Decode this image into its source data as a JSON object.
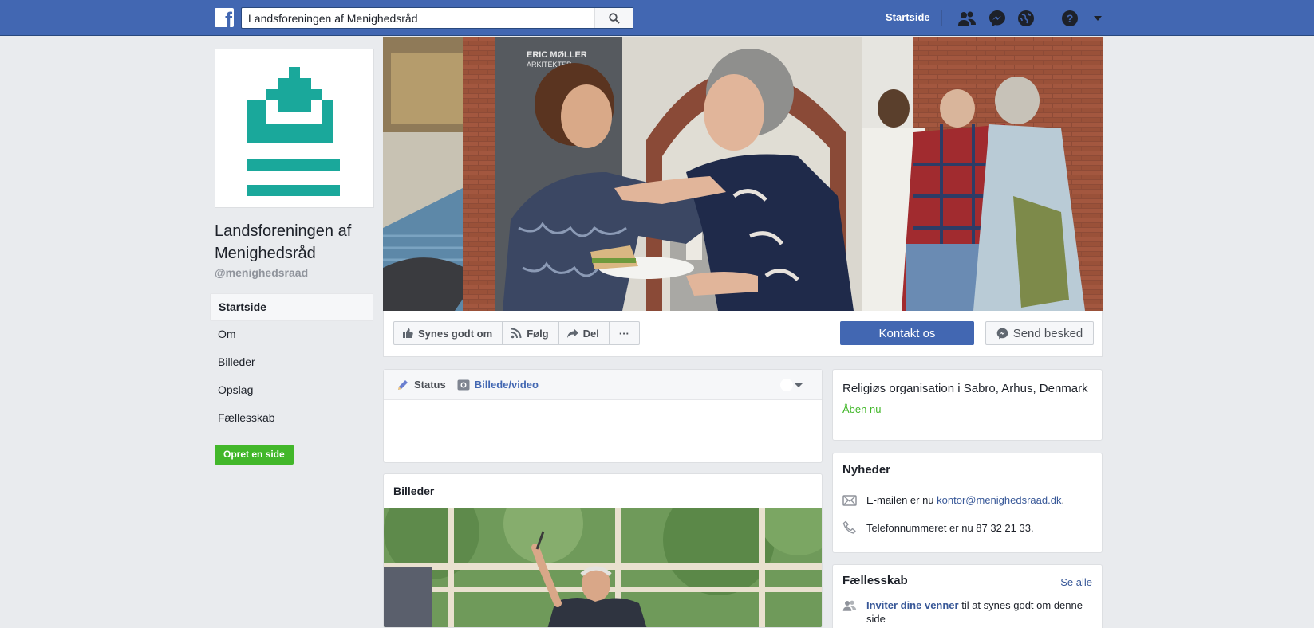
{
  "topbar": {
    "logo": "f",
    "search_value": "Landsforeningen af Menighedsråd",
    "search_icon": "search-icon",
    "home_label": "Startside",
    "icons": [
      "friend-requests-icon",
      "messenger-icon",
      "notifications-globe-icon",
      "help-icon",
      "caret-down-icon"
    ]
  },
  "page": {
    "name": "Landsforeningen af Menighedsråd",
    "handle": "@menighedsraad",
    "logo_color": "#1aa89b"
  },
  "leftnav": {
    "items": [
      {
        "label": "Startside",
        "active": true
      },
      {
        "label": "Om"
      },
      {
        "label": "Billeder"
      },
      {
        "label": "Opslag"
      },
      {
        "label": "Fællesskab"
      }
    ],
    "create_page": "Opret en side"
  },
  "actions": {
    "like": "Synes godt om",
    "follow": "Følg",
    "share": "Del",
    "more": "···",
    "contact": "Kontakt os",
    "message": "Send besked"
  },
  "cover": {
    "banner_text_1": "ERIC MØLLER",
    "banner_text_2": "ARKITEKTER"
  },
  "composer": {
    "status": "Status",
    "photo_video": "Billede/video"
  },
  "photos": {
    "title": "Billeder"
  },
  "info": {
    "category": "Religiøs organisation i Sabro, Arhus, Denmark",
    "open": "Åben nu"
  },
  "news": {
    "title": "Nyheder",
    "email_prefix": "E-mailen er nu ",
    "email": "kontor@menighedsraad.dk",
    "email_suffix": ".",
    "phone": "Telefonnummeret er nu 87 32 21 33."
  },
  "community": {
    "title": "Fællesskab",
    "see_all": "Se alle",
    "invite_link": "Inviter dine venner",
    "invite_text": " til at synes godt om denne side"
  },
  "colors": {
    "brand_blue": "#4267b2",
    "green": "#42b72a",
    "link": "#385898"
  }
}
